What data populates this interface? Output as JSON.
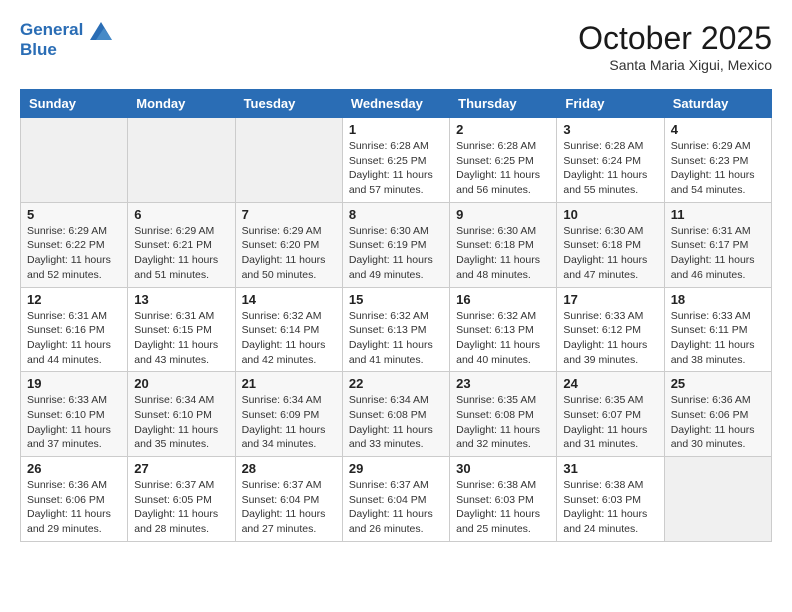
{
  "header": {
    "logo_line1": "General",
    "logo_line2": "Blue",
    "month": "October 2025",
    "location": "Santa Maria Xigui, Mexico"
  },
  "weekdays": [
    "Sunday",
    "Monday",
    "Tuesday",
    "Wednesday",
    "Thursday",
    "Friday",
    "Saturday"
  ],
  "weeks": [
    [
      {
        "day": "",
        "info": ""
      },
      {
        "day": "",
        "info": ""
      },
      {
        "day": "",
        "info": ""
      },
      {
        "day": "1",
        "info": "Sunrise: 6:28 AM\nSunset: 6:25 PM\nDaylight: 11 hours\nand 57 minutes."
      },
      {
        "day": "2",
        "info": "Sunrise: 6:28 AM\nSunset: 6:25 PM\nDaylight: 11 hours\nand 56 minutes."
      },
      {
        "day": "3",
        "info": "Sunrise: 6:28 AM\nSunset: 6:24 PM\nDaylight: 11 hours\nand 55 minutes."
      },
      {
        "day": "4",
        "info": "Sunrise: 6:29 AM\nSunset: 6:23 PM\nDaylight: 11 hours\nand 54 minutes."
      }
    ],
    [
      {
        "day": "5",
        "info": "Sunrise: 6:29 AM\nSunset: 6:22 PM\nDaylight: 11 hours\nand 52 minutes."
      },
      {
        "day": "6",
        "info": "Sunrise: 6:29 AM\nSunset: 6:21 PM\nDaylight: 11 hours\nand 51 minutes."
      },
      {
        "day": "7",
        "info": "Sunrise: 6:29 AM\nSunset: 6:20 PM\nDaylight: 11 hours\nand 50 minutes."
      },
      {
        "day": "8",
        "info": "Sunrise: 6:30 AM\nSunset: 6:19 PM\nDaylight: 11 hours\nand 49 minutes."
      },
      {
        "day": "9",
        "info": "Sunrise: 6:30 AM\nSunset: 6:18 PM\nDaylight: 11 hours\nand 48 minutes."
      },
      {
        "day": "10",
        "info": "Sunrise: 6:30 AM\nSunset: 6:18 PM\nDaylight: 11 hours\nand 47 minutes."
      },
      {
        "day": "11",
        "info": "Sunrise: 6:31 AM\nSunset: 6:17 PM\nDaylight: 11 hours\nand 46 minutes."
      }
    ],
    [
      {
        "day": "12",
        "info": "Sunrise: 6:31 AM\nSunset: 6:16 PM\nDaylight: 11 hours\nand 44 minutes."
      },
      {
        "day": "13",
        "info": "Sunrise: 6:31 AM\nSunset: 6:15 PM\nDaylight: 11 hours\nand 43 minutes."
      },
      {
        "day": "14",
        "info": "Sunrise: 6:32 AM\nSunset: 6:14 PM\nDaylight: 11 hours\nand 42 minutes."
      },
      {
        "day": "15",
        "info": "Sunrise: 6:32 AM\nSunset: 6:13 PM\nDaylight: 11 hours\nand 41 minutes."
      },
      {
        "day": "16",
        "info": "Sunrise: 6:32 AM\nSunset: 6:13 PM\nDaylight: 11 hours\nand 40 minutes."
      },
      {
        "day": "17",
        "info": "Sunrise: 6:33 AM\nSunset: 6:12 PM\nDaylight: 11 hours\nand 39 minutes."
      },
      {
        "day": "18",
        "info": "Sunrise: 6:33 AM\nSunset: 6:11 PM\nDaylight: 11 hours\nand 38 minutes."
      }
    ],
    [
      {
        "day": "19",
        "info": "Sunrise: 6:33 AM\nSunset: 6:10 PM\nDaylight: 11 hours\nand 37 minutes."
      },
      {
        "day": "20",
        "info": "Sunrise: 6:34 AM\nSunset: 6:10 PM\nDaylight: 11 hours\nand 35 minutes."
      },
      {
        "day": "21",
        "info": "Sunrise: 6:34 AM\nSunset: 6:09 PM\nDaylight: 11 hours\nand 34 minutes."
      },
      {
        "day": "22",
        "info": "Sunrise: 6:34 AM\nSunset: 6:08 PM\nDaylight: 11 hours\nand 33 minutes."
      },
      {
        "day": "23",
        "info": "Sunrise: 6:35 AM\nSunset: 6:08 PM\nDaylight: 11 hours\nand 32 minutes."
      },
      {
        "day": "24",
        "info": "Sunrise: 6:35 AM\nSunset: 6:07 PM\nDaylight: 11 hours\nand 31 minutes."
      },
      {
        "day": "25",
        "info": "Sunrise: 6:36 AM\nSunset: 6:06 PM\nDaylight: 11 hours\nand 30 minutes."
      }
    ],
    [
      {
        "day": "26",
        "info": "Sunrise: 6:36 AM\nSunset: 6:06 PM\nDaylight: 11 hours\nand 29 minutes."
      },
      {
        "day": "27",
        "info": "Sunrise: 6:37 AM\nSunset: 6:05 PM\nDaylight: 11 hours\nand 28 minutes."
      },
      {
        "day": "28",
        "info": "Sunrise: 6:37 AM\nSunset: 6:04 PM\nDaylight: 11 hours\nand 27 minutes."
      },
      {
        "day": "29",
        "info": "Sunrise: 6:37 AM\nSunset: 6:04 PM\nDaylight: 11 hours\nand 26 minutes."
      },
      {
        "day": "30",
        "info": "Sunrise: 6:38 AM\nSunset: 6:03 PM\nDaylight: 11 hours\nand 25 minutes."
      },
      {
        "day": "31",
        "info": "Sunrise: 6:38 AM\nSunset: 6:03 PM\nDaylight: 11 hours\nand 24 minutes."
      },
      {
        "day": "",
        "info": ""
      }
    ]
  ]
}
